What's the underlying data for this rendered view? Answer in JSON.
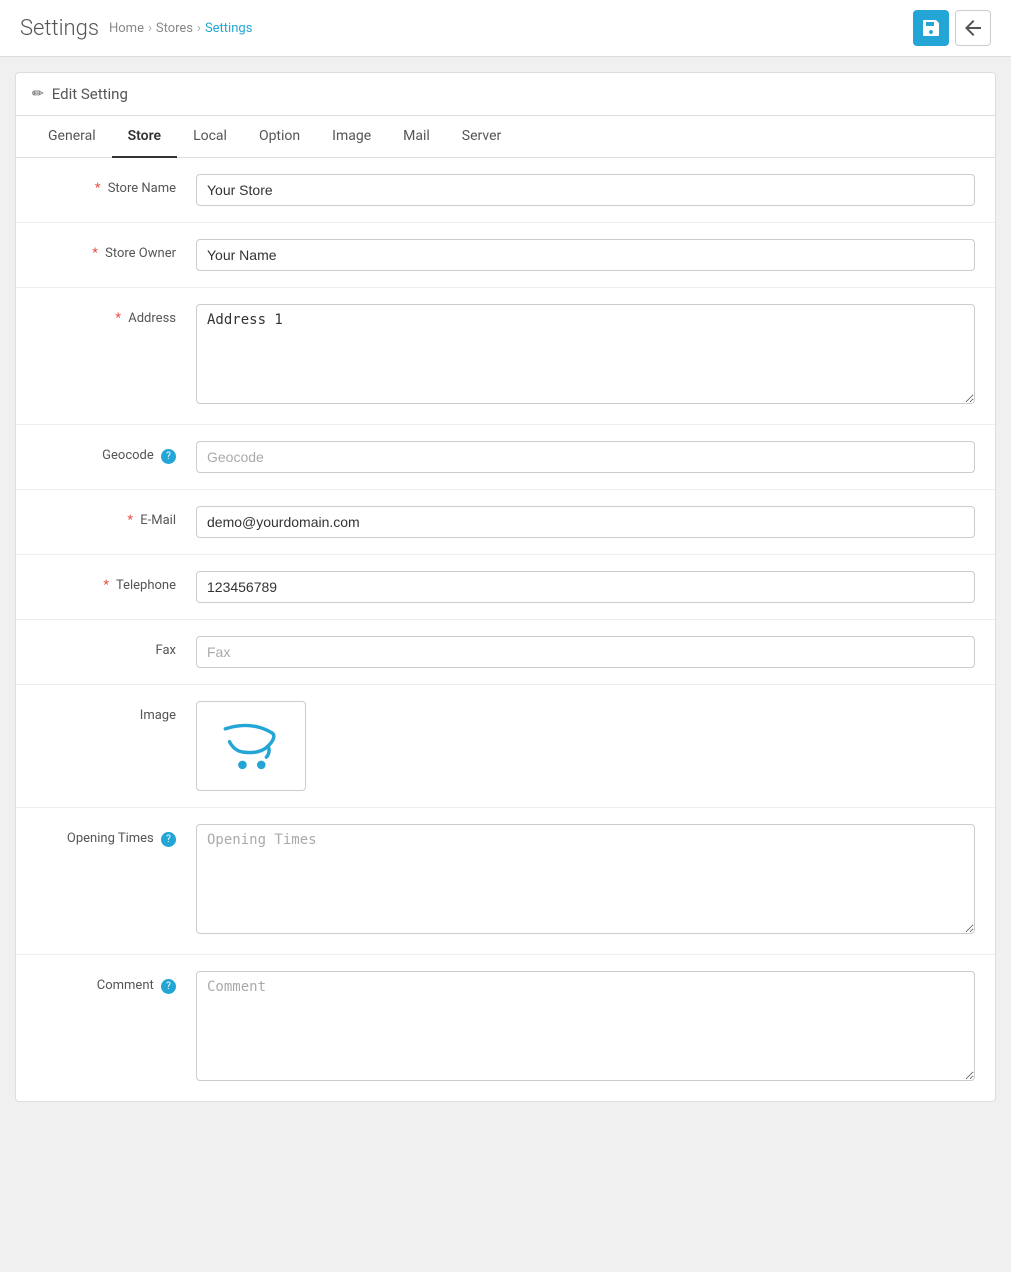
{
  "topbar": {
    "title": "Settings",
    "breadcrumb": [
      {
        "label": "Home",
        "active": false
      },
      {
        "label": "Stores",
        "active": false
      },
      {
        "label": "Settings",
        "active": true
      }
    ],
    "save_button_icon": "save-icon",
    "back_button_icon": "back-icon"
  },
  "card": {
    "header": "Edit Setting",
    "pencil_icon": "✏"
  },
  "tabs": [
    {
      "label": "General",
      "active": false
    },
    {
      "label": "Store",
      "active": true
    },
    {
      "label": "Local",
      "active": false
    },
    {
      "label": "Option",
      "active": false
    },
    {
      "label": "Image",
      "active": false
    },
    {
      "label": "Mail",
      "active": false
    },
    {
      "label": "Server",
      "active": false
    }
  ],
  "form": {
    "store_name": {
      "label": "Store Name",
      "required": true,
      "value": "Your Store",
      "placeholder": "Your Store"
    },
    "store_owner": {
      "label": "Store Owner",
      "required": true,
      "value": "Your Name",
      "placeholder": "Your Name"
    },
    "address": {
      "label": "Address",
      "required": true,
      "value": "Address 1",
      "placeholder": "Address 1"
    },
    "geocode": {
      "label": "Geocode",
      "required": false,
      "has_help": true,
      "value": "",
      "placeholder": "Geocode"
    },
    "email": {
      "label": "E-Mail",
      "required": true,
      "value": "demo@yourdomain.com",
      "placeholder": "demo@yourdomain.com"
    },
    "telephone": {
      "label": "Telephone",
      "required": true,
      "value": "123456789",
      "placeholder": "123456789"
    },
    "fax": {
      "label": "Fax",
      "required": false,
      "value": "",
      "placeholder": "Fax"
    },
    "image": {
      "label": "Image"
    },
    "opening_times": {
      "label": "Opening Times",
      "required": false,
      "has_help": true,
      "value": "",
      "placeholder": "Opening Times"
    },
    "comment": {
      "label": "Comment",
      "required": false,
      "has_help": true,
      "value": "",
      "placeholder": "Comment"
    }
  },
  "help_icon_label": "?",
  "sep": "›"
}
